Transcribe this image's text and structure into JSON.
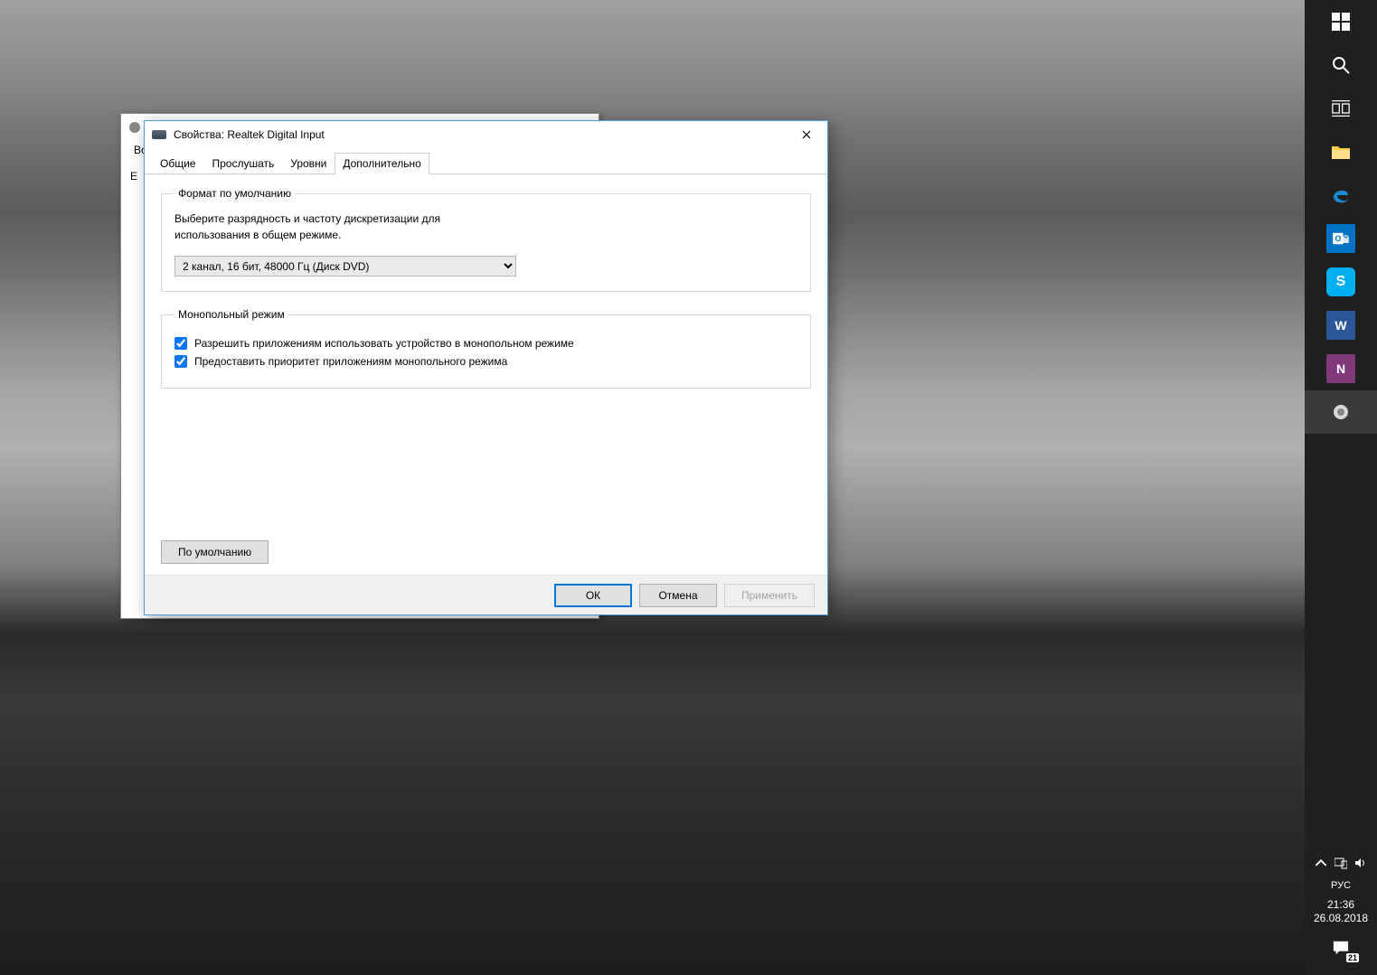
{
  "bg_window": {
    "tab0_hint": "Во",
    "body_hint": "Е"
  },
  "dialog": {
    "title": "Свойства: Realtek Digital Input",
    "tabs": [
      "Общие",
      "Прослушать",
      "Уровни",
      "Дополнительно"
    ],
    "active_tab_index": 3,
    "default_format": {
      "legend": "Формат по умолчанию",
      "description": "Выберите разрядность и частоту дискретизации для использования в общем режиме.",
      "selected": "2 канал, 16 бит, 48000 Гц (Диск DVD)"
    },
    "exclusive_mode": {
      "legend": "Монопольный режим",
      "checkbox1": {
        "label": "Разрешить приложениям использовать устройство в монопольном режиме",
        "checked": true
      },
      "checkbox2": {
        "label": "Предоставить приоритет приложениям монопольного режима",
        "checked": true
      }
    },
    "defaults_button": "По умолчанию",
    "buttons": {
      "ok": "ОК",
      "cancel": "Отмена",
      "apply": "Применить"
    }
  },
  "taskbar": {
    "language": "РУС",
    "time": "21:36",
    "date": "26.08.2018",
    "notif_count": "21",
    "apps": {
      "outlook": "O",
      "skype": "S",
      "word": "W",
      "onenote": "N"
    }
  }
}
